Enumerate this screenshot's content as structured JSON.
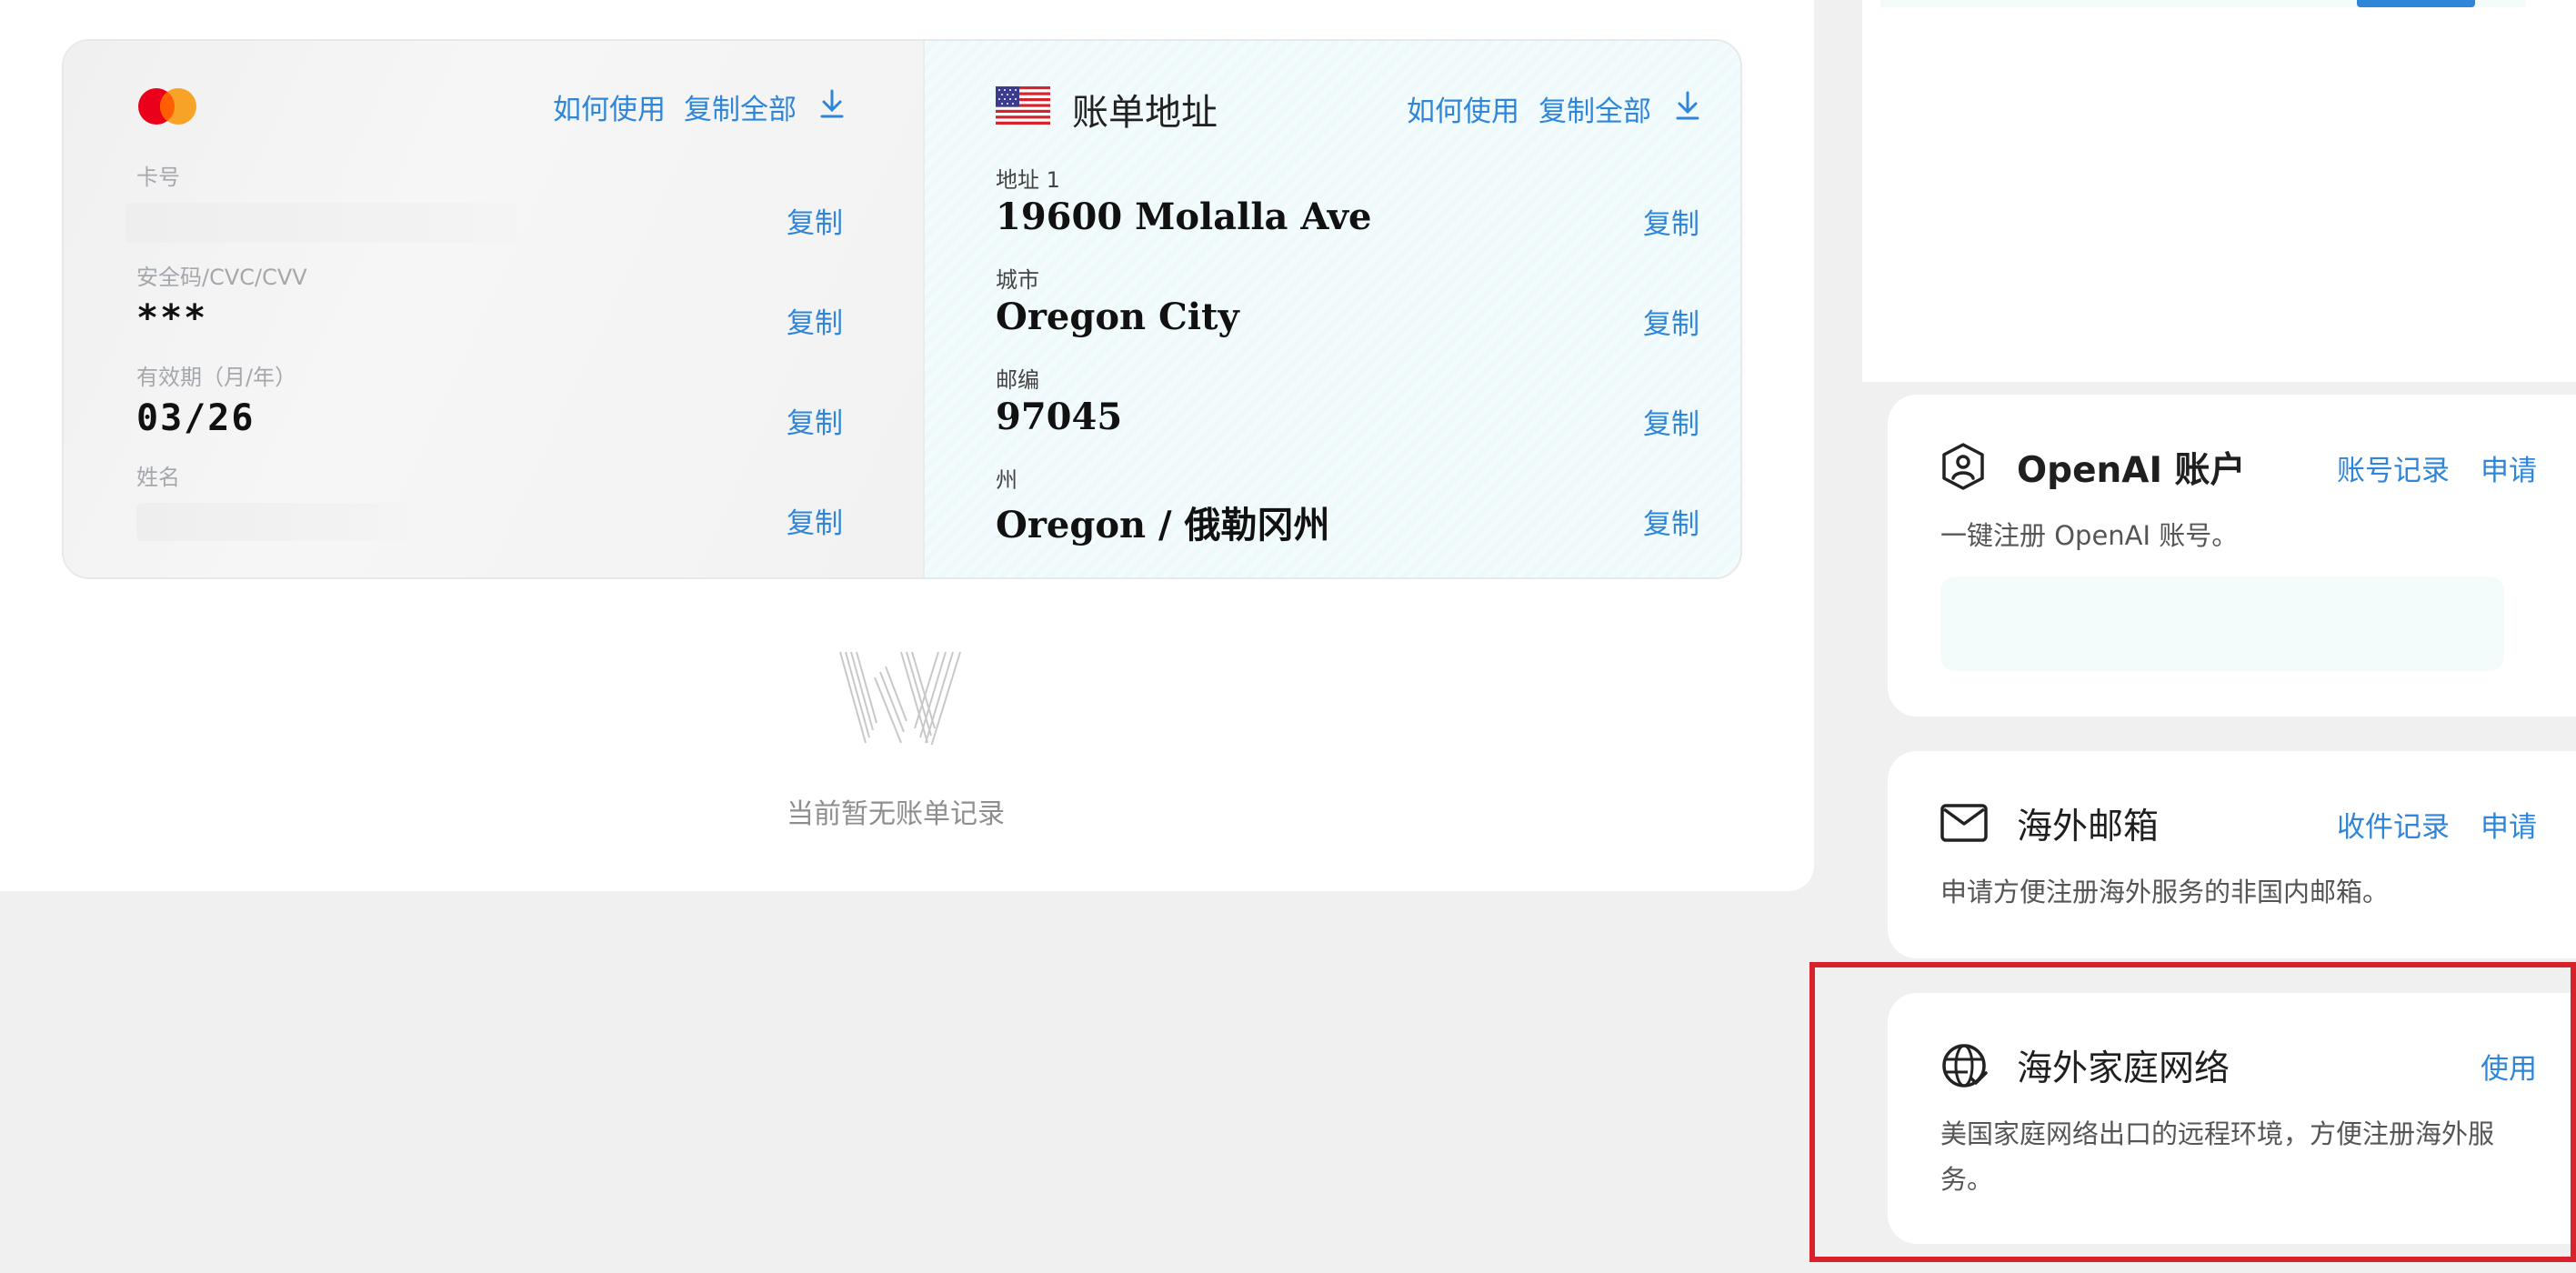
{
  "card": {
    "how_to_use": "如何使用",
    "copy_all": "复制全部",
    "copy": "复制",
    "number_label": "卡号",
    "cvc_label": "安全码/CVC/CVV",
    "cvc_value": "***",
    "expiry_label": "有效期（月/年）",
    "expiry_value": "03/26",
    "name_label": "姓名"
  },
  "billing": {
    "title": "账单地址",
    "how_to_use": "如何使用",
    "copy_all": "复制全部",
    "copy": "复制",
    "address_label": "地址 1",
    "address_value": "19600 Molalla Ave",
    "city_label": "城市",
    "city_value": "Oregon City",
    "zip_label": "邮编",
    "zip_value": "97045",
    "state_label": "州",
    "state_value": "Oregon / 俄勒冈州"
  },
  "empty_state": {
    "text": "当前暂无账单记录"
  },
  "side": {
    "openai": {
      "title": "OpenAI 账户",
      "link_records": "账号记录",
      "link_apply": "申请",
      "desc": "一键注册 OpenAI 账号。"
    },
    "mail": {
      "title": "海外邮箱",
      "link_records": "收件记录",
      "link_apply": "申请",
      "desc": "申请方便注册海外服务的非国内邮箱。"
    },
    "network": {
      "title": "海外家庭网络",
      "link_use": "使用",
      "desc": "美国家庭网络出口的远程环境，方便注册海外服务。"
    }
  },
  "colors": {
    "accent": "#2f86d8",
    "highlight": "#d8222c",
    "mastercard_red": "#eb001b",
    "mastercard_orange": "#f79e1b"
  },
  "icons": {
    "card_brand": "mastercard-logo",
    "flag": "us-flag-icon",
    "download": "download-icon",
    "openai": "user-shield-icon",
    "mail": "mail-icon",
    "network": "globe-icon"
  }
}
